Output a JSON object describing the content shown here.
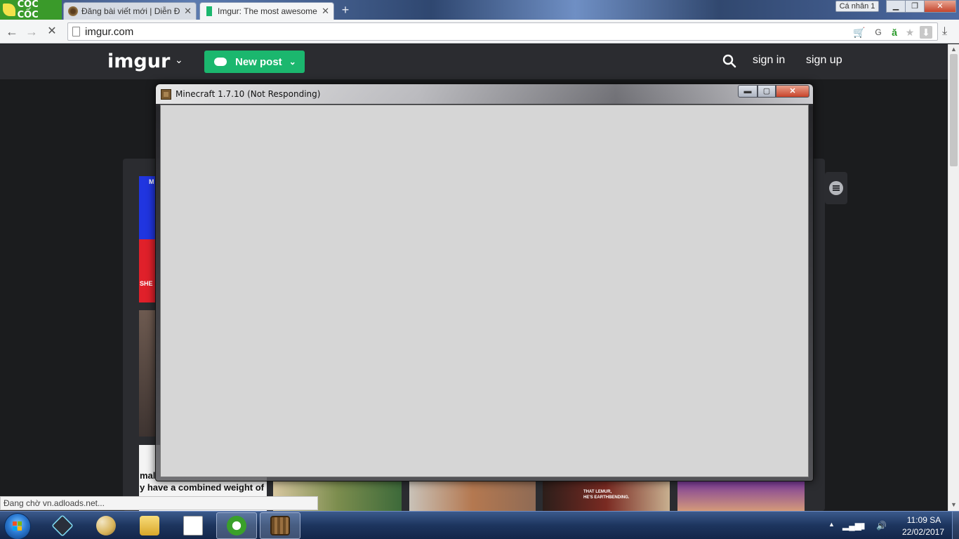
{
  "browser": {
    "brand": "CỐC CỐC",
    "tabs": [
      {
        "title": "Đăng bài viết mới | Diễn Đ",
        "active": false
      },
      {
        "title": "Imgur: The most awesome",
        "active": true
      }
    ],
    "new_tab_glyph": "+",
    "profile_label": "Cá nhân 1",
    "url": "imgur.com",
    "status_text": "Đang chờ vn.adloads.net..."
  },
  "imgur": {
    "logo": "imgur",
    "new_post_label": "New post",
    "sign_in": "sign in",
    "sign_up": "sign up",
    "thumb_texts": {
      "caption_top": "M",
      "caption_she": "SHE",
      "caption_mal": "mal",
      "caption_weight": "y have a combined weight of",
      "lemur_line1": "THAT LEMUR,",
      "lemur_line2": "HE'S EARTHBENDING."
    }
  },
  "minecraft_window": {
    "title": "Minecraft 1.7.10 (Not Responding)",
    "min_glyph": "▬",
    "max_glyph": "▢",
    "close_glyph": "✕"
  },
  "taskbar": {
    "apps": [
      "nox",
      "paint",
      "explorer",
      "unikey",
      "coccoc",
      "minecraft"
    ],
    "time": "11:09 SA",
    "date": "22/02/2017"
  },
  "colors": {
    "imgur_nav": "#2b2c30",
    "new_post_green": "#1bb76e",
    "client_gray": "#d6d6d6"
  }
}
